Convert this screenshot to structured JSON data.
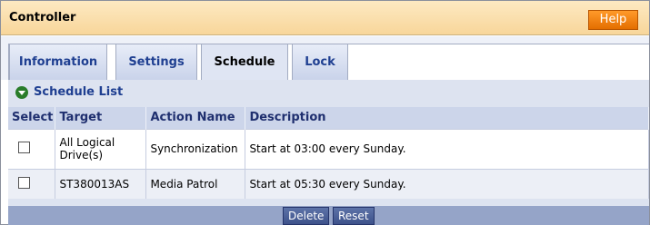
{
  "header": {
    "title": "Controller",
    "help_label": "Help"
  },
  "tabs": [
    {
      "label": "Information",
      "active": false
    },
    {
      "label": "Settings",
      "active": false
    },
    {
      "label": "Schedule",
      "active": true
    },
    {
      "label": "Lock",
      "active": false
    }
  ],
  "section": {
    "title": "Schedule List",
    "icon": "expand-arrow-icon"
  },
  "table": {
    "columns": [
      "Select",
      "Target",
      "Action Name",
      "Description"
    ],
    "rows": [
      {
        "selected": false,
        "target": "All Logical Drive(s)",
        "action": "Synchronization",
        "description": "Start at 03:00 every Sunday."
      },
      {
        "selected": false,
        "target": "ST380013AS",
        "action": "Media Patrol",
        "description": "Start at 05:30 every Sunday."
      }
    ]
  },
  "buttons": {
    "delete_label": "Delete",
    "reset_label": "Reset"
  }
}
